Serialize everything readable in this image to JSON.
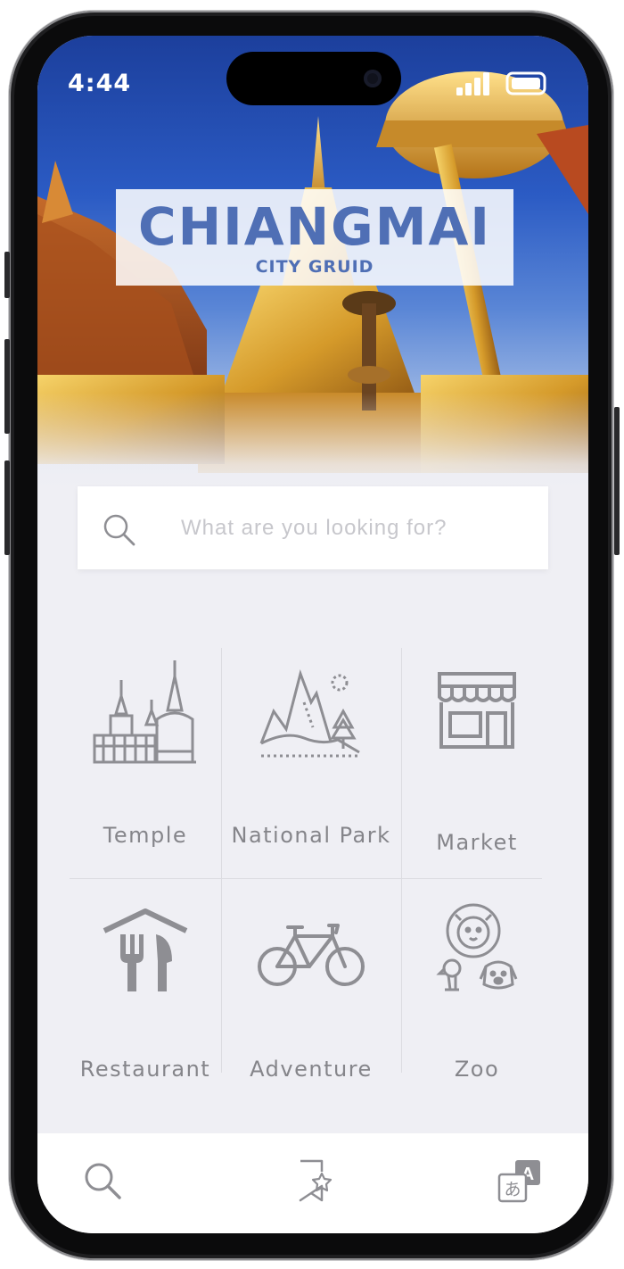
{
  "status_bar": {
    "time": "4:44"
  },
  "hero": {
    "title": "CHIANGMAI",
    "subtitle": "CITY GRUID"
  },
  "search": {
    "placeholder": "What are you looking for?"
  },
  "categories": [
    {
      "label": "Temple",
      "icon": "temple-icon"
    },
    {
      "label": "National Park",
      "icon": "mountain-icon"
    },
    {
      "label": "Market",
      "icon": "storefront-icon"
    },
    {
      "label": "Restaurant",
      "icon": "restaurant-icon"
    },
    {
      "label": "Adventure",
      "icon": "bicycle-icon"
    },
    {
      "label": "Zoo",
      "icon": "zoo-animals-icon"
    }
  ],
  "tab_bar": {
    "items": [
      {
        "icon": "search-icon"
      },
      {
        "icon": "bookmark-star-icon"
      },
      {
        "icon": "translate-icon"
      }
    ]
  },
  "colors": {
    "title_blue": "#4f6fb5",
    "icon_gray": "#85858a",
    "background": "#efeff4",
    "placeholder": "#c7c7cc"
  }
}
